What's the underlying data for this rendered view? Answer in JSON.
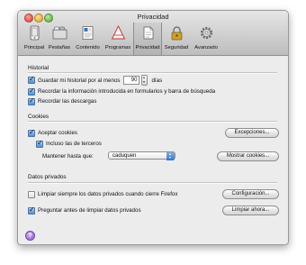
{
  "window": {
    "title": "Privacidad"
  },
  "toolbar": {
    "items": [
      {
        "label": "Principal",
        "icon": "phone-icon"
      },
      {
        "label": "Pestañas",
        "icon": "tabs-icon"
      },
      {
        "label": "Contenido",
        "icon": "document-icon"
      },
      {
        "label": "Programas",
        "icon": "apps-icon"
      },
      {
        "label": "Privacidad",
        "icon": "mask-icon",
        "active": true
      },
      {
        "label": "Seguridad",
        "icon": "lock-icon"
      },
      {
        "label": "Avanzado",
        "icon": "gear-icon"
      }
    ]
  },
  "history": {
    "section_title": "Historial",
    "keep_history_label": "Guardar mi historial por al menos",
    "keep_history_checked": true,
    "days_value": "90",
    "days_unit": "días",
    "forms_label": "Recordar la información introducida en formularios y barra de búsqueda",
    "forms_checked": true,
    "downloads_label": "Recordar las descargas",
    "downloads_checked": true
  },
  "cookies": {
    "section_title": "Cookies",
    "accept_label": "Aceptar cookies",
    "accept_checked": true,
    "third_party_label": "Incluso las de terceros",
    "third_party_checked": true,
    "keep_until_label": "Mantener hasta que:",
    "keep_until_value": "caduquen",
    "exceptions_button": "Excepciones...",
    "show_cookies_button": "Mostrar cookies..."
  },
  "private_data": {
    "section_title": "Datos privados",
    "always_clear_label": "Limpiar siempre los datos privados cuando cierre Firefox",
    "always_clear_checked": false,
    "ask_before_label": "Preguntar antes de limpiar datos privados",
    "ask_before_checked": true,
    "settings_button": "Configuración...",
    "clear_now_button": "Limpiar ahora..."
  },
  "help": {
    "label": "?"
  }
}
